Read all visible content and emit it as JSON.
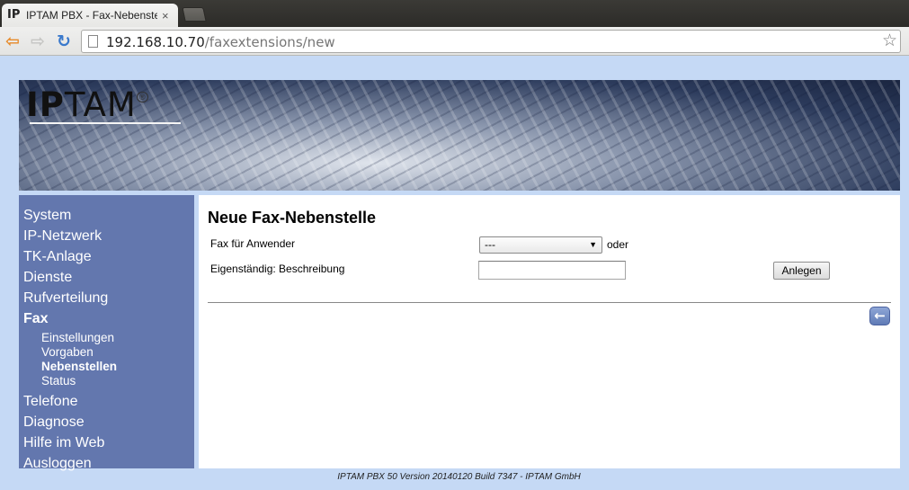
{
  "browser": {
    "tab_title": "IPTAM PBX - Fax-Nebenstelle",
    "tab_favicon": "IP",
    "tab_close": "×",
    "url_host": "192.168.10.70",
    "url_path": "/faxextensions/new",
    "icons": {
      "back": "back-arrow-icon",
      "forward": "forward-arrow-icon",
      "reload": "reload-icon",
      "bookmark": "star-icon"
    }
  },
  "banner": {
    "logo_bold": "IP",
    "logo_rest": "TAM",
    "logo_mark": "®"
  },
  "sidebar": {
    "items": [
      {
        "label": "System"
      },
      {
        "label": "IP-Netzwerk"
      },
      {
        "label": "TK-Anlage"
      },
      {
        "label": "Dienste"
      },
      {
        "label": "Rufverteilung"
      },
      {
        "label": "Fax",
        "active": true
      },
      {
        "label": "Telefone"
      },
      {
        "label": "Diagnose"
      },
      {
        "label": "Hilfe im Web"
      },
      {
        "label": "Ausloggen"
      }
    ],
    "fax_submenu": [
      {
        "label": "Einstellungen"
      },
      {
        "label": "Vorgaben"
      },
      {
        "label": "Nebenstellen",
        "active": true
      },
      {
        "label": "Status"
      }
    ]
  },
  "main": {
    "title": "Neue Fax-Nebenstelle",
    "user_label": "Fax für Anwender",
    "user_select_value": "---",
    "or_text": "oder",
    "desc_label": "Eigenständig: Beschreibung",
    "desc_value": "",
    "submit_label": "Anlegen",
    "back_icon": "back-arrow-icon"
  },
  "footer": {
    "text": "IPTAM PBX 50 Version 20140120 Build 7347 - IPTAM GmbH"
  },
  "colors": {
    "page_background": "#c5d9f5",
    "sidebar_background": "#6377ae",
    "content_background": "#ffffff"
  }
}
